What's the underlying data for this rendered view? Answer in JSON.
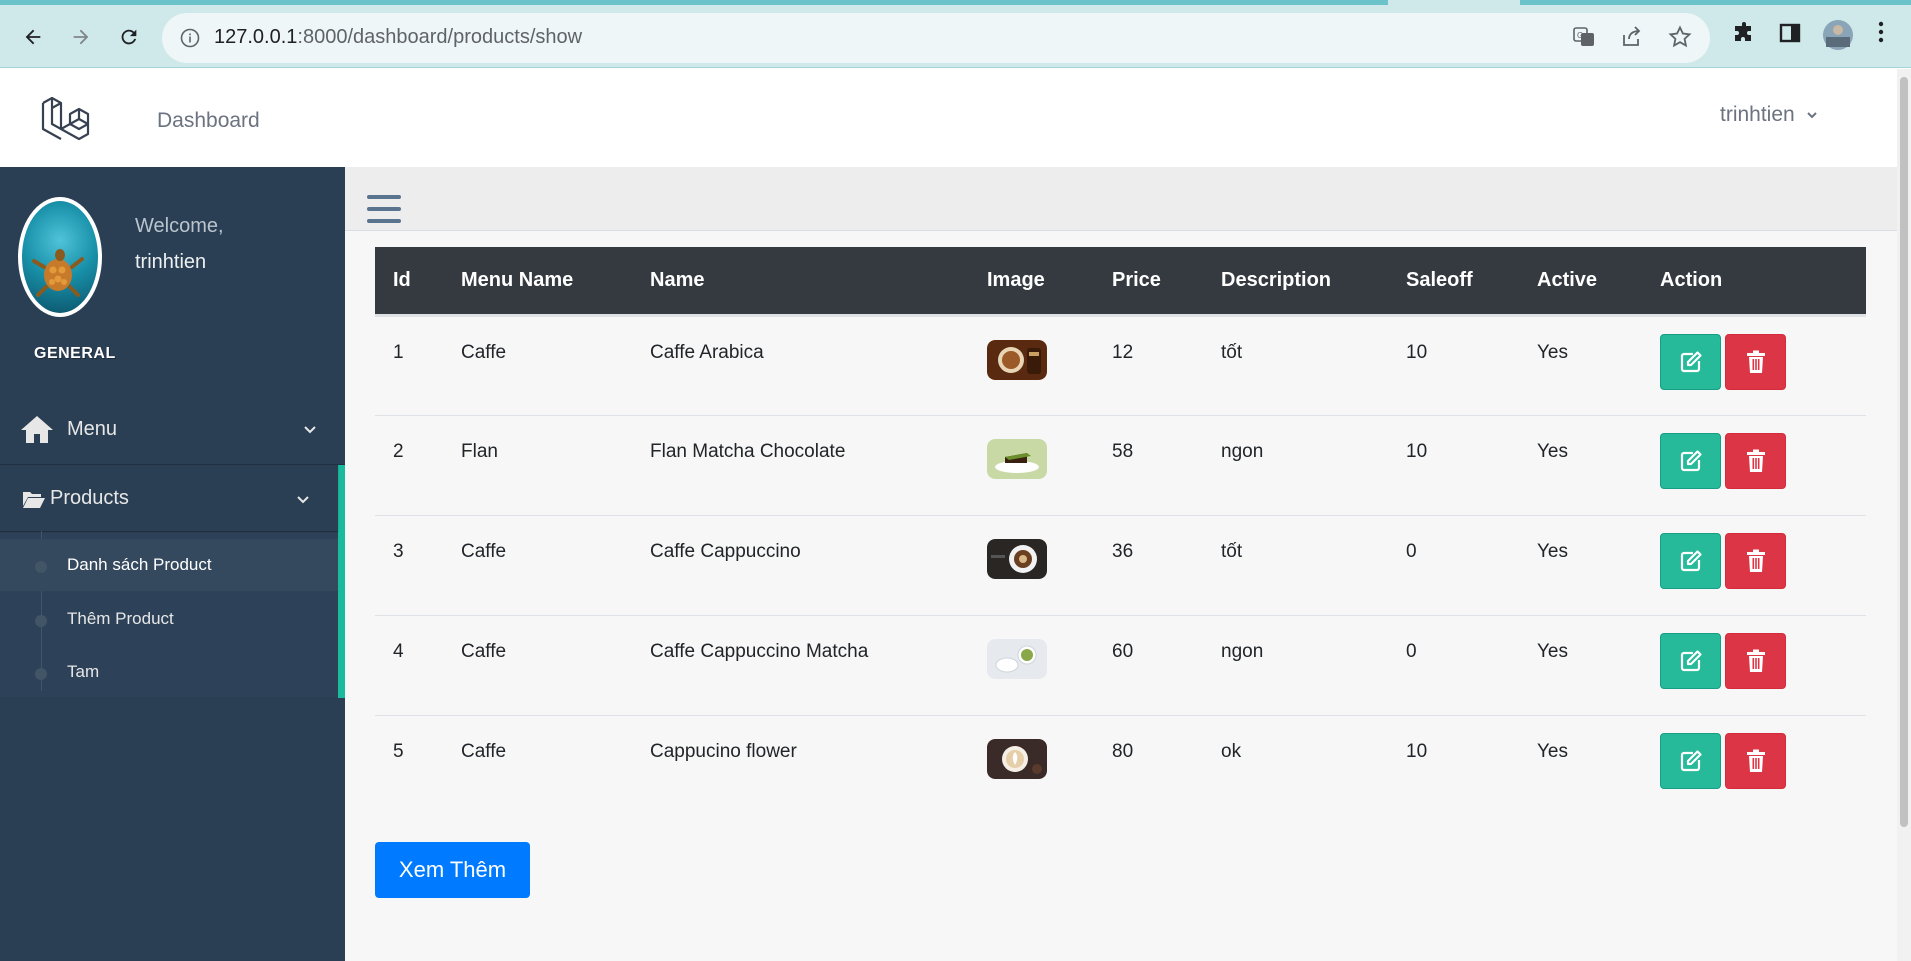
{
  "browser": {
    "url_host": "127.0.0.1",
    "url_rest": ":8000/dashboard/products/show"
  },
  "header": {
    "dashboard_link": "Dashboard",
    "user_name": "trinhtien"
  },
  "sidebar": {
    "welcome": "Welcome,",
    "username": "trinhtien",
    "section_title": "GENERAL",
    "menu_label": "Menu",
    "products_label": "Products",
    "children": [
      {
        "label": "Danh sách Product",
        "active": true
      },
      {
        "label": "Thêm Product",
        "active": false
      },
      {
        "label": "Tam",
        "active": false
      }
    ]
  },
  "table": {
    "headers": [
      "Id",
      "Menu Name",
      "Name",
      "Image",
      "Price",
      "Description",
      "Saleoff",
      "Active",
      "Action"
    ],
    "rows": [
      {
        "id": "1",
        "menu": "Caffe",
        "name": "Caffe Arabica",
        "price": "12",
        "desc": "tốt",
        "saleoff": "10",
        "active": "Yes"
      },
      {
        "id": "2",
        "menu": "Flan",
        "name": "Flan Matcha Chocolate",
        "price": "58",
        "desc": "ngon",
        "saleoff": "10",
        "active": "Yes"
      },
      {
        "id": "3",
        "menu": "Caffe",
        "name": "Caffe Cappuccino",
        "price": "36",
        "desc": "tốt",
        "saleoff": "0",
        "active": "Yes"
      },
      {
        "id": "4",
        "menu": "Caffe",
        "name": "Caffe Cappuccino Matcha",
        "price": "60",
        "desc": "ngon",
        "saleoff": "0",
        "active": "Yes"
      },
      {
        "id": "5",
        "menu": "Caffe",
        "name": "Cappucino flower",
        "price": "80",
        "desc": "ok",
        "saleoff": "10",
        "active": "Yes"
      }
    ]
  },
  "more_button": "Xem Thêm",
  "colors": {
    "sidebar_bg": "#2a3f54",
    "accent_green": "#26b99a",
    "danger_red": "#dc3545",
    "primary_blue": "#007bff",
    "table_head": "#343a40"
  }
}
